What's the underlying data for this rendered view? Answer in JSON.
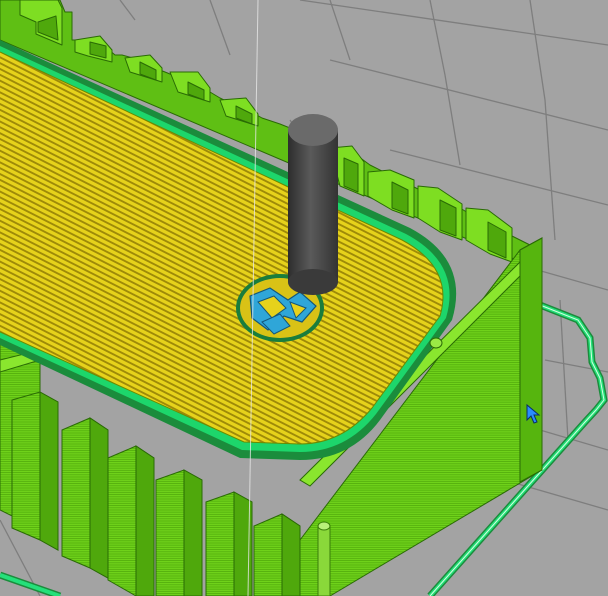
{
  "app": "slicer-layer-preview",
  "viewport": {
    "background_color": "#a3a3a3",
    "grid_color": "#7d7d7d"
  },
  "colors": {
    "perimeter": "#7ede22",
    "perimeter_dark": "#4fb70a",
    "perimeter_outline": "#2a6b05",
    "infill": "#e6d21b",
    "infill_dark": "#b69c0b",
    "external_perimeter": "#1cc862",
    "support_blue": "#2fa6d8",
    "nozzle": "#4a4a4a",
    "skirt": "#1dd66b"
  },
  "icons": [
    "mouse-cursor-icon"
  ]
}
